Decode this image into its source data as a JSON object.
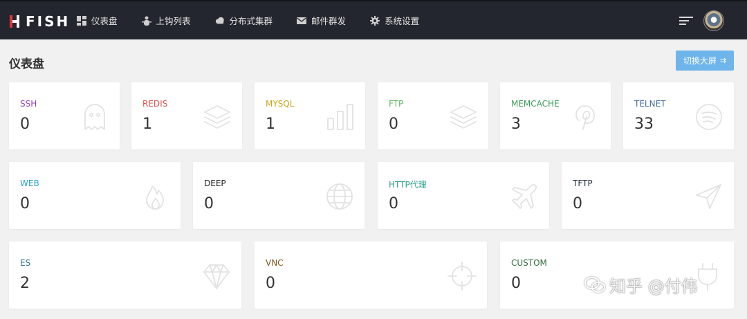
{
  "header": {
    "logo_text": "FISH",
    "nav": [
      {
        "label": "仪表盘",
        "icon": "dashboard-icon"
      },
      {
        "label": "上钩列表",
        "icon": "bug-icon"
      },
      {
        "label": "分布式集群",
        "icon": "cloud-icon"
      },
      {
        "label": "邮件群发",
        "icon": "mail-icon"
      },
      {
        "label": "系统设置",
        "icon": "gear-icon"
      }
    ]
  },
  "page": {
    "title": "仪表盘",
    "switch_button": "切换大屏"
  },
  "cards": [
    {
      "name": "SSH",
      "value": "0",
      "color": "#8e44ad",
      "icon": "ghost-icon"
    },
    {
      "name": "REDIS",
      "value": "1",
      "color": "#d9534f",
      "icon": "layers-icon"
    },
    {
      "name": "MYSQL",
      "value": "1",
      "color": "#c8a418",
      "icon": "bar-chart-icon"
    },
    {
      "name": "FTP",
      "value": "0",
      "color": "#5cb85c",
      "icon": "layers-icon"
    },
    {
      "name": "MEMCACHE",
      "value": "3",
      "color": "#3a9a5c",
      "icon": "pinterest-icon"
    },
    {
      "name": "TELNET",
      "value": "33",
      "color": "#4a6fa5",
      "icon": "spotify-icon"
    },
    {
      "name": "WEB",
      "value": "0",
      "color": "#2ea0d6",
      "icon": "fire-icon"
    },
    {
      "name": "DEEP",
      "value": "0",
      "color": "#222222",
      "icon": "globe-icon"
    },
    {
      "name": "HTTP代理",
      "value": "0",
      "color": "#30a28f",
      "icon": "plane-icon"
    },
    {
      "name": "TFTP",
      "value": "0",
      "color": "#1f2d3d",
      "icon": "send-icon"
    },
    {
      "name": "ES",
      "value": "2",
      "color": "#2f6f95",
      "icon": "diamond-icon"
    },
    {
      "name": "VNC",
      "value": "0",
      "color": "#7a5a1e",
      "icon": "crosshair-icon"
    },
    {
      "name": "CUSTOM",
      "value": "0",
      "color": "#2e6b3a",
      "icon": "plug-icon"
    }
  ],
  "watermark": "知乎 @付伟"
}
